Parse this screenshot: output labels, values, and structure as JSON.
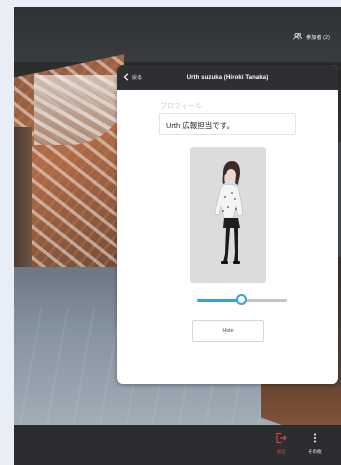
{
  "header": {
    "participants_label": "参加者 (2)"
  },
  "profile_panel": {
    "back_label": "戻る",
    "title": "Urth suzuka (Hiroki Tanaka)",
    "section_label": "プロフィール",
    "bio": "Urth 広報担当です。",
    "avatar_scale": 0.5,
    "hide_button_label": "Hide"
  },
  "toolbar": {
    "leave_label": "退出",
    "more_label": "その他"
  },
  "colors": {
    "accent": "#3aa1d9",
    "leave": "#e0454b",
    "panel_header": "#2d2f33",
    "toolbar": "#2b2d31"
  },
  "icons": {
    "participants": "people-icon",
    "back": "chevron-left-icon",
    "leave": "exit-icon",
    "more": "kebab-icon"
  }
}
